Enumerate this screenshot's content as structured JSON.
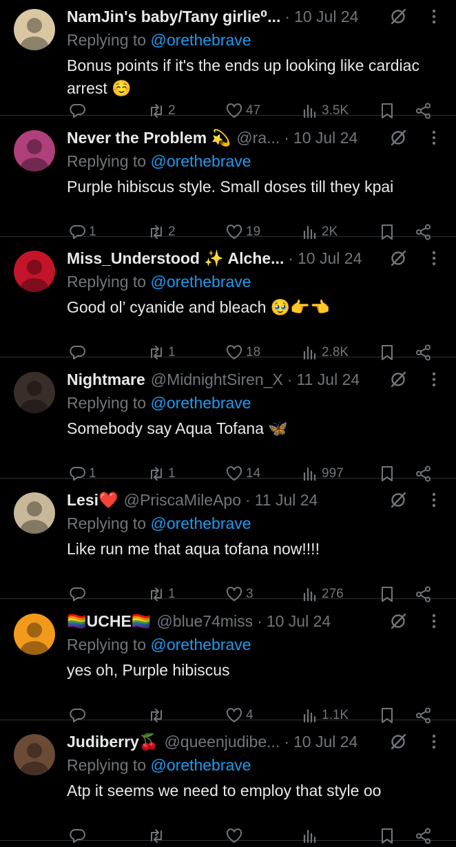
{
  "replying_label": "Replying to",
  "replies": [
    {
      "name": "NamJin's baby/Tany girlie⁰...",
      "handle": "",
      "date": "10 Jul 24",
      "mention": "@orethebrave",
      "text": "Bonus points if it's the ends up looking like cardiac arrest ☺️",
      "reply_count": "",
      "retweets": "2",
      "likes": "47",
      "views": "3.5K",
      "avatar_color": "#d9c7a3"
    },
    {
      "name": "Never the Problem 💫",
      "handle": "@ra...",
      "date": "10 Jul 24",
      "mention": "@orethebrave",
      "text": "Purple hibiscus style. Small doses till they kpai",
      "reply_count": "1",
      "retweets": "2",
      "likes": "19",
      "views": "2K",
      "avatar_color": "#b0407c"
    },
    {
      "name": "Miss_Understood ✨ Alche...",
      "handle": "",
      "date": "10 Jul 24",
      "mention": "@orethebrave",
      "text": "Good ol’ cyanide and bleach 🥹👉👈",
      "reply_count": "",
      "retweets": "1",
      "likes": "18",
      "views": "2.8K",
      "avatar_color": "#c4142a"
    },
    {
      "name": "Nightmare",
      "handle": "@MidnightSiren_X",
      "date": "11 Jul 24",
      "mention": "@orethebrave",
      "text": "Somebody say Aqua Tofana 🦋",
      "reply_count": "1",
      "retweets": "1",
      "likes": "14",
      "views": "997",
      "avatar_color": "#3a2e2a"
    },
    {
      "name": "Lesi❤️",
      "handle": "@PriscaMileApo",
      "date": "11 Jul 24",
      "mention": "@orethebrave",
      "text": "Like run me that aqua tofana now!!!!",
      "reply_count": "",
      "retweets": "1",
      "likes": "3",
      "views": "276",
      "avatar_color": "#c8b89a"
    },
    {
      "name": "🏳️‍🌈UCHE🏳️‍🌈",
      "handle": "@blue74miss",
      "date": "10 Jul 24",
      "mention": "@orethebrave",
      "text": "yes oh, Purple hibiscus",
      "reply_count": "",
      "retweets": "",
      "likes": "4",
      "views": "1.1K",
      "avatar_color": "#f39a1c"
    },
    {
      "name": "Judiberry🍒",
      "handle": "@queenjudibe...",
      "date": "10 Jul 24",
      "mention": "@orethebrave",
      "text": "Atp it seems we need to employ that style oo",
      "reply_count": "",
      "retweets": "",
      "likes": "",
      "views": "",
      "avatar_color": "#6b4a36"
    }
  ]
}
